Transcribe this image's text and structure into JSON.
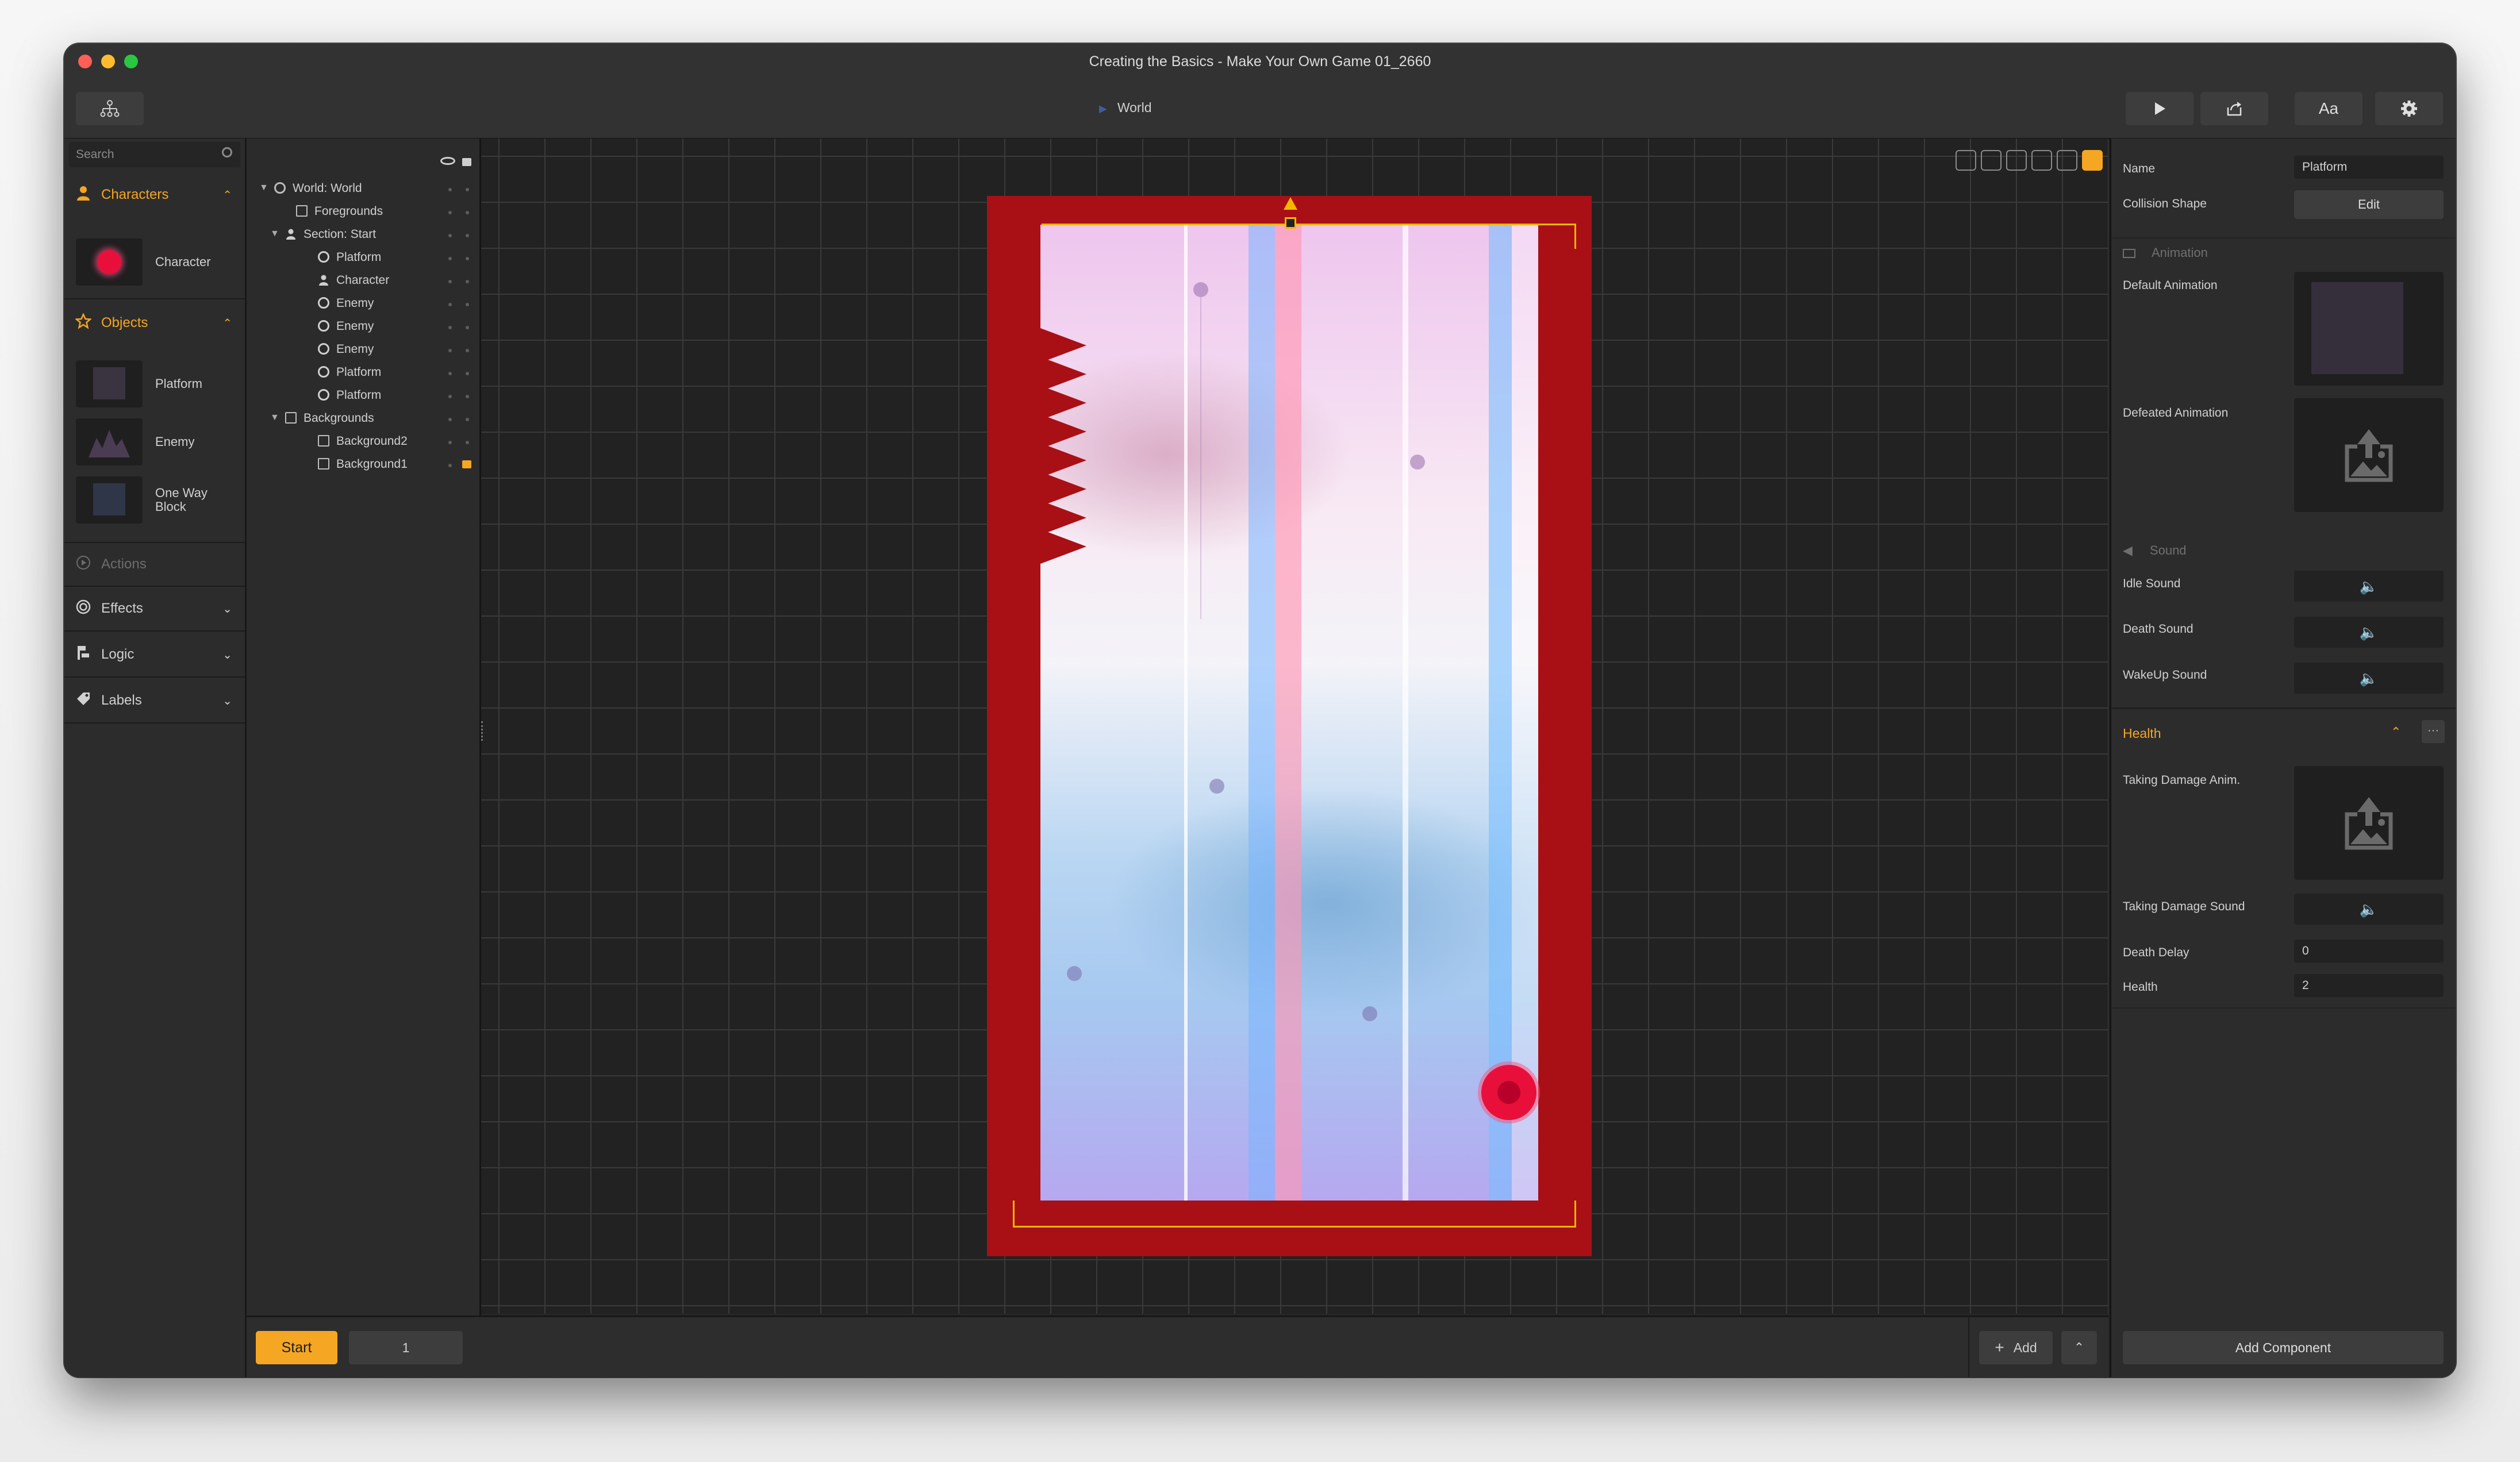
{
  "window": {
    "title": "Creating the Basics - Make Your Own Game 01_2660",
    "breadcrumb": "World"
  },
  "toolbar": {
    "play_icon": "play-icon",
    "share_icon": "share-icon",
    "font_label": "Aa",
    "settings_icon": "gear-icon"
  },
  "library": {
    "search_placeholder": "Search",
    "categories": {
      "characters": "Characters",
      "objects": "Objects",
      "actions": "Actions",
      "effects": "Effects",
      "logic": "Logic",
      "labels": "Labels"
    },
    "characters": [
      {
        "label": "Character"
      }
    ],
    "objects": [
      {
        "label": "Platform"
      },
      {
        "label": "Enemy"
      },
      {
        "label": "One Way Block"
      }
    ]
  },
  "hierarchy": {
    "rows": [
      {
        "name": "World: World",
        "icon": "globe-icon"
      },
      {
        "name": "Foregrounds",
        "icon": "image-icon"
      },
      {
        "name": "Section: Start",
        "icon": "person-icon"
      },
      {
        "name": "Platform",
        "icon": "circle-icon"
      },
      {
        "name": "Character",
        "icon": "person-icon"
      },
      {
        "name": "Enemy",
        "icon": "circle-icon"
      },
      {
        "name": "Enemy",
        "icon": "circle-icon"
      },
      {
        "name": "Enemy",
        "icon": "circle-icon"
      },
      {
        "name": "Platform",
        "icon": "circle-icon"
      },
      {
        "name": "Platform",
        "icon": "circle-icon"
      },
      {
        "name": "Backgrounds",
        "icon": "image-icon"
      },
      {
        "name": "Background2",
        "icon": "image-icon"
      },
      {
        "name": "Background1",
        "icon": "image-icon"
      }
    ]
  },
  "bottombar": {
    "start_label": "Start",
    "page_value": "1",
    "add_label": "Add"
  },
  "inspector": {
    "name_label": "Name",
    "name_value": "Platform",
    "collision_label": "Collision Shape",
    "edit_label": "Edit",
    "animation_header": "Animation",
    "default_animation": "Default Animation",
    "defeated_animation": "Defeated Animation",
    "sound_header": "Sound",
    "idle_sound": "Idle Sound",
    "death_sound": "Death Sound",
    "wakeup_sound": "WakeUp Sound",
    "health_header": "Health",
    "more_label": "···",
    "taking_damage_anim": "Taking Damage Anim.",
    "taking_damage_sound": "Taking Damage Sound",
    "death_delay_label": "Death Delay",
    "death_delay_value": "0",
    "health_label": "Health",
    "health_value": "2",
    "add_component": "Add Component"
  },
  "colors": {
    "accent": "#f5a623",
    "stage_red": "#a81016",
    "selection": "#f5b800",
    "character": "#e8103a"
  }
}
